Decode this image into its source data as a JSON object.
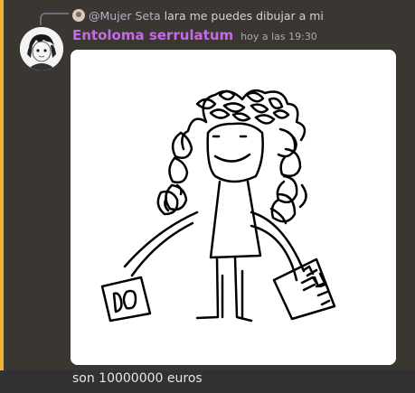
{
  "reply": {
    "username": "@Mujer Seta",
    "text": "lara me puedes dibujar a mi"
  },
  "message": {
    "author": "Entoloma serrulatum",
    "timestamp": "hoy a las 19:30",
    "author_color": "#c768e6"
  },
  "drawing": {
    "sign_left": "DO",
    "sign_right": "ME DIECE"
  },
  "next_message": {
    "text": "son 10000000 euros"
  },
  "colors": {
    "mention_bar": "#f0b232",
    "background": "#3a3836"
  }
}
